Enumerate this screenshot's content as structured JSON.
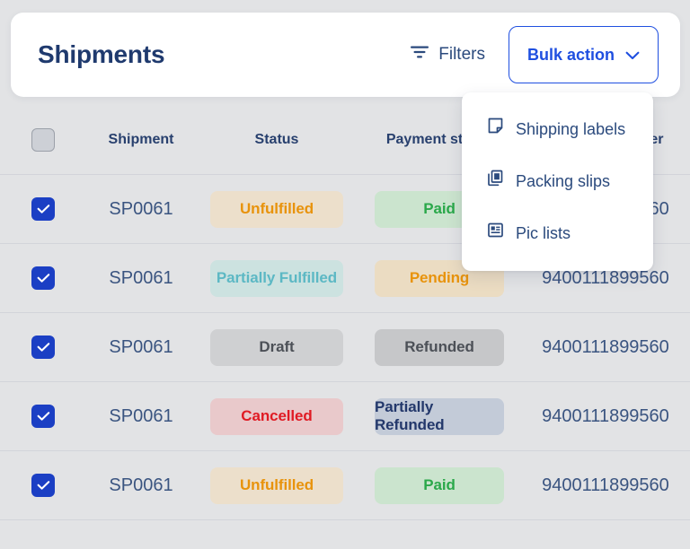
{
  "header": {
    "title": "Shipments",
    "filters_label": "Filters",
    "filters_icon": "filter-icon",
    "bulk_action_label": "Bulk action",
    "bulk_action_icon": "chevron-down-icon"
  },
  "dropdown": {
    "items": [
      {
        "label": "Shipping labels",
        "icon": "document-icon"
      },
      {
        "label": "Packing slips",
        "icon": "copy-pages-icon"
      },
      {
        "label": "Pic lists",
        "icon": "list-card-icon"
      }
    ]
  },
  "table": {
    "headers": {
      "select_all": "",
      "shipment": "Shipment",
      "status": "Status",
      "payment_status": "Payment status",
      "tracking": "Tracking number"
    },
    "rows": [
      {
        "selected": true,
        "shipment": "SP0061",
        "status": "Unfulfilled",
        "status_bg": "#ecdfcb",
        "status_fg": "#e8930c",
        "payment": "Paid",
        "payment_bg": "#cbe4ce",
        "payment_fg": "#2aa84a",
        "tracking": "9400111899560"
      },
      {
        "selected": true,
        "shipment": "SP0061",
        "status": "Partially Fulfilled",
        "status_bg": "#cce2e0",
        "status_fg": "#5cb8c4",
        "payment": "Pending",
        "payment_bg": "#ebdcc2",
        "payment_fg": "#e8930c",
        "tracking": "9400111899560"
      },
      {
        "selected": true,
        "shipment": "SP0061",
        "status": "Draft",
        "status_bg": "#cfd0d2",
        "status_fg": "#4c5057",
        "payment": "Refunded",
        "payment_bg": "#c6c7c9",
        "payment_fg": "#4c5057",
        "tracking": "9400111899560"
      },
      {
        "selected": true,
        "shipment": "SP0061",
        "status": "Cancelled",
        "status_bg": "#e9c9cb",
        "status_fg": "#e01b24",
        "payment": "Partially Refunded",
        "payment_bg": "#c3cbd8",
        "payment_fg": "#23386b",
        "tracking": "9400111899560"
      },
      {
        "selected": true,
        "shipment": "SP0061",
        "status": "Unfulfilled",
        "status_bg": "#ecdfcb",
        "status_fg": "#e8930c",
        "payment": "Paid",
        "payment_bg": "#cbe4ce",
        "payment_fg": "#2aa84a",
        "tracking": "9400111899560"
      }
    ]
  },
  "colors": {
    "accent_blue": "#1f4fe0",
    "checkbox_blue": "#1b3fc4",
    "title_navy": "#1f3a6e",
    "page_bg": "#e2e3e5"
  }
}
